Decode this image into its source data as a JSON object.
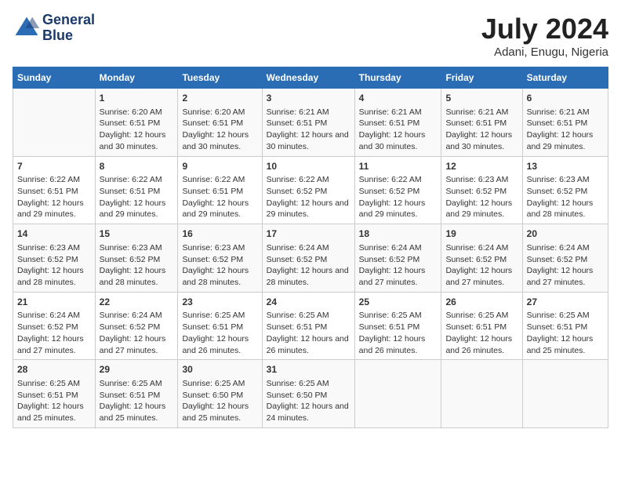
{
  "header": {
    "logo_line1": "General",
    "logo_line2": "Blue",
    "month": "July 2024",
    "location": "Adani, Enugu, Nigeria"
  },
  "weekdays": [
    "Sunday",
    "Monday",
    "Tuesday",
    "Wednesday",
    "Thursday",
    "Friday",
    "Saturday"
  ],
  "weeks": [
    [
      {
        "day": "",
        "sunrise": "",
        "sunset": "",
        "daylight": ""
      },
      {
        "day": "1",
        "sunrise": "6:20 AM",
        "sunset": "6:51 PM",
        "daylight": "12 hours and 30 minutes."
      },
      {
        "day": "2",
        "sunrise": "6:20 AM",
        "sunset": "6:51 PM",
        "daylight": "12 hours and 30 minutes."
      },
      {
        "day": "3",
        "sunrise": "6:21 AM",
        "sunset": "6:51 PM",
        "daylight": "12 hours and 30 minutes."
      },
      {
        "day": "4",
        "sunrise": "6:21 AM",
        "sunset": "6:51 PM",
        "daylight": "12 hours and 30 minutes."
      },
      {
        "day": "5",
        "sunrise": "6:21 AM",
        "sunset": "6:51 PM",
        "daylight": "12 hours and 30 minutes."
      },
      {
        "day": "6",
        "sunrise": "6:21 AM",
        "sunset": "6:51 PM",
        "daylight": "12 hours and 29 minutes."
      }
    ],
    [
      {
        "day": "7",
        "sunrise": "6:22 AM",
        "sunset": "6:51 PM",
        "daylight": "12 hours and 29 minutes."
      },
      {
        "day": "8",
        "sunrise": "6:22 AM",
        "sunset": "6:51 PM",
        "daylight": "12 hours and 29 minutes."
      },
      {
        "day": "9",
        "sunrise": "6:22 AM",
        "sunset": "6:51 PM",
        "daylight": "12 hours and 29 minutes."
      },
      {
        "day": "10",
        "sunrise": "6:22 AM",
        "sunset": "6:52 PM",
        "daylight": "12 hours and 29 minutes."
      },
      {
        "day": "11",
        "sunrise": "6:22 AM",
        "sunset": "6:52 PM",
        "daylight": "12 hours and 29 minutes."
      },
      {
        "day": "12",
        "sunrise": "6:23 AM",
        "sunset": "6:52 PM",
        "daylight": "12 hours and 29 minutes."
      },
      {
        "day": "13",
        "sunrise": "6:23 AM",
        "sunset": "6:52 PM",
        "daylight": "12 hours and 28 minutes."
      }
    ],
    [
      {
        "day": "14",
        "sunrise": "6:23 AM",
        "sunset": "6:52 PM",
        "daylight": "12 hours and 28 minutes."
      },
      {
        "day": "15",
        "sunrise": "6:23 AM",
        "sunset": "6:52 PM",
        "daylight": "12 hours and 28 minutes."
      },
      {
        "day": "16",
        "sunrise": "6:23 AM",
        "sunset": "6:52 PM",
        "daylight": "12 hours and 28 minutes."
      },
      {
        "day": "17",
        "sunrise": "6:24 AM",
        "sunset": "6:52 PM",
        "daylight": "12 hours and 28 minutes."
      },
      {
        "day": "18",
        "sunrise": "6:24 AM",
        "sunset": "6:52 PM",
        "daylight": "12 hours and 27 minutes."
      },
      {
        "day": "19",
        "sunrise": "6:24 AM",
        "sunset": "6:52 PM",
        "daylight": "12 hours and 27 minutes."
      },
      {
        "day": "20",
        "sunrise": "6:24 AM",
        "sunset": "6:52 PM",
        "daylight": "12 hours and 27 minutes."
      }
    ],
    [
      {
        "day": "21",
        "sunrise": "6:24 AM",
        "sunset": "6:52 PM",
        "daylight": "12 hours and 27 minutes."
      },
      {
        "day": "22",
        "sunrise": "6:24 AM",
        "sunset": "6:52 PM",
        "daylight": "12 hours and 27 minutes."
      },
      {
        "day": "23",
        "sunrise": "6:25 AM",
        "sunset": "6:51 PM",
        "daylight": "12 hours and 26 minutes."
      },
      {
        "day": "24",
        "sunrise": "6:25 AM",
        "sunset": "6:51 PM",
        "daylight": "12 hours and 26 minutes."
      },
      {
        "day": "25",
        "sunrise": "6:25 AM",
        "sunset": "6:51 PM",
        "daylight": "12 hours and 26 minutes."
      },
      {
        "day": "26",
        "sunrise": "6:25 AM",
        "sunset": "6:51 PM",
        "daylight": "12 hours and 26 minutes."
      },
      {
        "day": "27",
        "sunrise": "6:25 AM",
        "sunset": "6:51 PM",
        "daylight": "12 hours and 25 minutes."
      }
    ],
    [
      {
        "day": "28",
        "sunrise": "6:25 AM",
        "sunset": "6:51 PM",
        "daylight": "12 hours and 25 minutes."
      },
      {
        "day": "29",
        "sunrise": "6:25 AM",
        "sunset": "6:51 PM",
        "daylight": "12 hours and 25 minutes."
      },
      {
        "day": "30",
        "sunrise": "6:25 AM",
        "sunset": "6:50 PM",
        "daylight": "12 hours and 25 minutes."
      },
      {
        "day": "31",
        "sunrise": "6:25 AM",
        "sunset": "6:50 PM",
        "daylight": "12 hours and 24 minutes."
      },
      {
        "day": "",
        "sunrise": "",
        "sunset": "",
        "daylight": ""
      },
      {
        "day": "",
        "sunrise": "",
        "sunset": "",
        "daylight": ""
      },
      {
        "day": "",
        "sunrise": "",
        "sunset": "",
        "daylight": ""
      }
    ]
  ]
}
